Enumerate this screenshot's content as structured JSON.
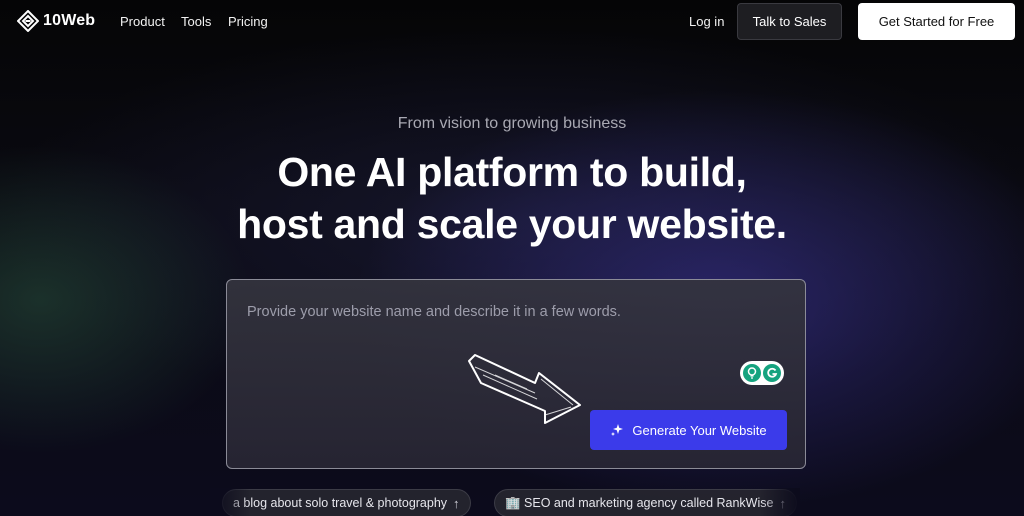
{
  "nav": {
    "brand": "10Web",
    "links": [
      "Product",
      "Tools",
      "Pricing"
    ],
    "login": "Log in",
    "talk_to_sales": "Talk to Sales",
    "get_started": "Get Started for Free"
  },
  "hero": {
    "eyebrow": "From vision to growing business",
    "headline_line1": "One AI platform to build,",
    "headline_line2": "host and scale your website."
  },
  "prompt": {
    "placeholder": "Provide your website name and describe it in a few words.",
    "generate_label": "Generate Your Website"
  },
  "suggestions": [
    {
      "text": "a blog about solo travel & photography",
      "icon": "arrow-up-icon"
    },
    {
      "text": "🏢 SEO and marketing agency called RankWise",
      "icon": "arrow-up-icon"
    }
  ],
  "colors": {
    "accent": "#3b3bea",
    "background": "#0a0a12",
    "grammarly": "#15a37f"
  }
}
